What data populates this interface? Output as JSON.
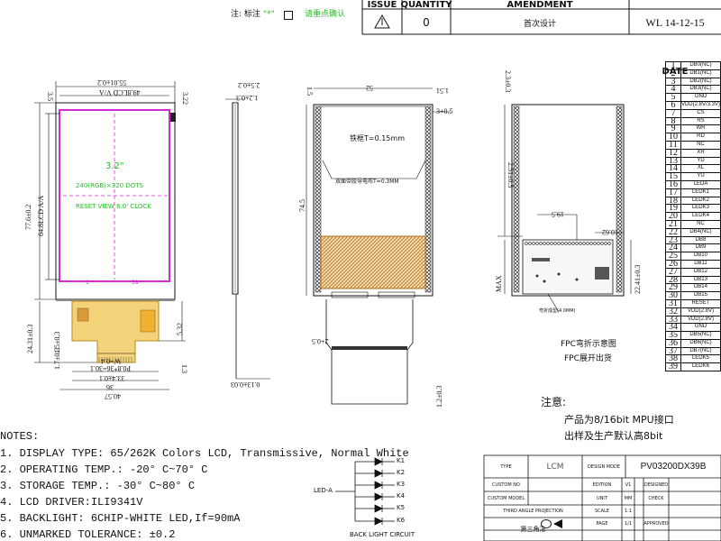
{
  "header": {
    "note_label": "注: 标注",
    "note_mark": "\"*\"",
    "note_tail": "请重点确认"
  },
  "revision": {
    "headers": [
      "ISSUE",
      "QUANTITY",
      "AMENDMENT",
      "DATE"
    ],
    "row": {
      "quantity": "0",
      "amendment": "首次设计",
      "date": "WL 14-12-15"
    }
  },
  "front_view": {
    "overall_width": "55.01±0.2",
    "va_width": "49.8LCD V/A",
    "aa_width": "48.6LCD A/A",
    "size_label": "3.2\"",
    "resolution": "240(RGB)×320 DOTS",
    "driver_line": "RESET VIEW 6.0' CLOCK",
    "top_offset": "3.5",
    "top_right": "3.22",
    "height_total": "77.6±0.2",
    "height_aa": "64.8LCD A/A",
    "fpc_height": "24.31±0.3",
    "fpc_right": "5.32",
    "fpc_left1": "1.7±0.3",
    "fpc_left2": "1.5±0.3",
    "fpc_pitch": "P0.8*36=30.1",
    "fpc_w1": "W=0.4",
    "fpc_w2": "33.4±0.1",
    "fpc_w3": "36",
    "fpc_w4": "40.57",
    "fpc_right2": "1.3",
    "pin1_label": "1",
    "pin39_label": "39"
  },
  "side_view": {
    "dim1": "2.5±0.2",
    "dim2": "1.2±0.3",
    "dim3": "0.13±0.03"
  },
  "back_view": {
    "top_width": "52",
    "top_dim1": "1.51",
    "top_dim2": "1.5",
    "top_right": "3+0.5",
    "height": "74.5",
    "bezel_note": "铁框T=0.15mm",
    "tape_note": "双面带胶导电布T=0.3MM",
    "bottom_dim": "2+0.5",
    "bottom_dim2": "1.2±0.3"
  },
  "fpc_view": {
    "top_dim": "2.3±0.3",
    "dim_a": "2.51±0.5",
    "dim_b": "19.5",
    "dim_c": "10.62",
    "dim_d": "22.41±0.3",
    "dim_max": "MAX",
    "small_text": "弯折成型(4.0MM)",
    "caption1": "FPC弯折示意图",
    "caption2": "FPC展开出货"
  },
  "pins": [
    {
      "no": "1",
      "name": "DB0(NC)"
    },
    {
      "no": "2",
      "name": "DB1(NC)"
    },
    {
      "no": "3",
      "name": "DB2(NC)"
    },
    {
      "no": "4",
      "name": "DB3(NC)"
    },
    {
      "no": "5",
      "name": "GND"
    },
    {
      "no": "6",
      "name": "VDD(2.8V/3.3V)"
    },
    {
      "no": "7",
      "name": "CS"
    },
    {
      "no": "8",
      "name": "RS"
    },
    {
      "no": "9",
      "name": "WR"
    },
    {
      "no": "10",
      "name": "RD"
    },
    {
      "no": "11",
      "name": "NC"
    },
    {
      "no": "12",
      "name": "XR"
    },
    {
      "no": "13",
      "name": "YD"
    },
    {
      "no": "14",
      "name": "XL"
    },
    {
      "no": "15",
      "name": "YU"
    },
    {
      "no": "16",
      "name": "LEDA"
    },
    {
      "no": "17",
      "name": "LEDK1"
    },
    {
      "no": "18",
      "name": "LEDK2"
    },
    {
      "no": "19",
      "name": "LEDK3"
    },
    {
      "no": "20",
      "name": "LEDK4"
    },
    {
      "no": "21",
      "name": "NC"
    },
    {
      "no": "22",
      "name": "DB4(NC)"
    },
    {
      "no": "23",
      "name": "DB8"
    },
    {
      "no": "24",
      "name": "DB9"
    },
    {
      "no": "25",
      "name": "DB10"
    },
    {
      "no": "26",
      "name": "DB11"
    },
    {
      "no": "27",
      "name": "DB12"
    },
    {
      "no": "28",
      "name": "DB13"
    },
    {
      "no": "29",
      "name": "DB14"
    },
    {
      "no": "30",
      "name": "DB15"
    },
    {
      "no": "31",
      "name": "RESET"
    },
    {
      "no": "32",
      "name": "VDD(2.8V)"
    },
    {
      "no": "33",
      "name": "VDD(2.8V)"
    },
    {
      "no": "34",
      "name": "GND"
    },
    {
      "no": "35",
      "name": "DB5(NC)"
    },
    {
      "no": "36",
      "name": "DB6(NC)"
    },
    {
      "no": "37",
      "name": "DB7(NC)"
    },
    {
      "no": "38",
      "name": "LEDK5"
    },
    {
      "no": "39",
      "name": "LEDK6"
    }
  ],
  "notice": {
    "title": "注意:",
    "line1": "产品为8/16bit MPU接口",
    "line2": "出样及生产默认高8bit"
  },
  "notes": {
    "title": "NOTES:",
    "items": [
      "1. DISPLAY TYPE: 65/262K  Colors LCD, Transmissive, Normal White",
      "2. OPERATING TEMP.: -20° C~70° C",
      "3. STORAGE TEMP.: -30° C~80° C",
      "4. LCD DRIVER:ILI9341V",
      "5. BACKLIGHT: 6CHIP-WHITE LED,If=90mA",
      "6. UNMARKED TOLERANCE:  ±0.2"
    ]
  },
  "backlight": {
    "anode": "LED-A",
    "cathodes": [
      "K1",
      "K2",
      "K3",
      "K4",
      "K5",
      "K6"
    ],
    "caption": "BACK LIGHT CIRCUIT"
  },
  "title_block": {
    "type_label": "TYPE",
    "type_value": "LCM",
    "design_mode_label": "DESIGN MODE",
    "design_mode_value": "PV03200DX39B",
    "custom_no_label": "CUSTOM NO",
    "custom_model_label": "CUSTOM MODEL",
    "edition_label": "EDITION",
    "edition_value": "V1",
    "unit_label": "UNIT",
    "unit_value": "MM",
    "scale_label": "SCALE",
    "scale_value": "1:1",
    "page_label": "PAGE",
    "page_value": "1/1",
    "designed_label": "DESIGNED",
    "check_label": "CHECK",
    "approved_label": "APPROVED",
    "projection_label": "THIRD ANGLE PROJECTION",
    "projection_cn": "第三角法"
  },
  "colors": {
    "lcd_outline": "#d42bd4",
    "dimension_text": "#1fbf1f",
    "guide_line": "#d42bd4",
    "hatch": "#b5711f",
    "fpc_fill": "#e8c85a"
  }
}
